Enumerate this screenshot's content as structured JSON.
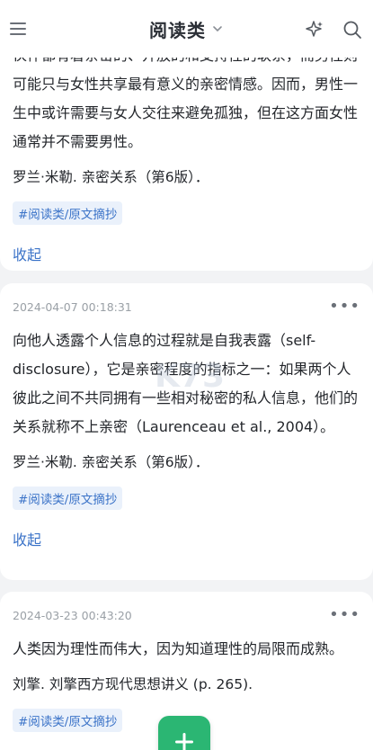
{
  "header": {
    "title": "阅读类",
    "icons": [
      "menu-icon",
      "chevron-down-icon",
      "sparkle-icon",
      "search-icon"
    ]
  },
  "notes": [
    {
      "text": "伙伴都有着亲密的、开放的和支持性的联系，而男性则可能只与女性共享最有意义的亲密情感。因而，男性一生中或许需要与女人交往来避免孤独，但在这方面女性通常并不需要男性。",
      "source": "罗兰·米勒. 亲密关系（第6版）．",
      "tag": "#阅读类/原文摘抄",
      "collapse_label": "收起"
    },
    {
      "timestamp": "2024-04-07 00:18:31",
      "more": "•••",
      "text": "向他人透露个人信息的过程就是自我表露（self-disclosure），它是亲密程度的指标之一：如果两个人彼此之间不共同拥有一些相对秘密的私人信息，他们的关系就称不上亲密（Laurenceau et al., 2004）。",
      "source": "罗兰·米勒. 亲密关系（第6版）．",
      "tag": "#阅读类/原文摘抄",
      "collapse_label": "收起"
    },
    {
      "timestamp": "2024-03-23 00:43:20",
      "more": "•••",
      "text": "人类因为理性而伟大，因为知道理性的局限而成熟。",
      "source": "刘擎. 刘擎西方现代思想讲义 (p. 265).",
      "tag": "#阅读类/原文摘抄"
    }
  ],
  "colors": {
    "accent": "#3b73c8",
    "tag_bg": "#eaf1fb",
    "fab": "#2bb673",
    "background": "#f2f3f5"
  },
  "watermark": "K73"
}
